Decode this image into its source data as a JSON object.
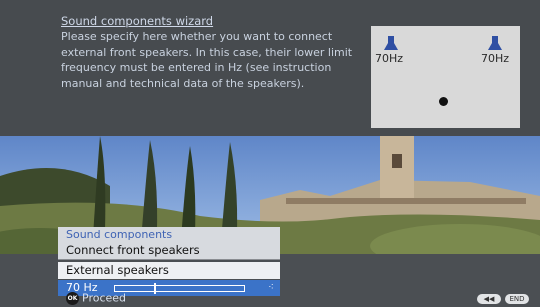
{
  "wizard": {
    "title": "Sound components wizard",
    "description": "Please specify here whether you want to connect external front speakers. In this case, their lower limit frequency must be entered in Hz (see instruction manual and technical data of the speakers)."
  },
  "diagram": {
    "left_speaker_freq": "70Hz",
    "right_speaker_freq": "70Hz"
  },
  "menu": {
    "header": "Sound components",
    "items": [
      "Connect front speakers",
      "External speakers"
    ],
    "value_label": "70 Hz",
    "slider_fraction": 0.3
  },
  "footer": {
    "ok_icon_text": "OK",
    "proceed_label": "Proceed",
    "back_label": "◀◀",
    "end_label": "END"
  },
  "colors": {
    "accent": "#3b73c8",
    "menu_bg": "#d7dadf",
    "header_text": "#3f63b4"
  }
}
